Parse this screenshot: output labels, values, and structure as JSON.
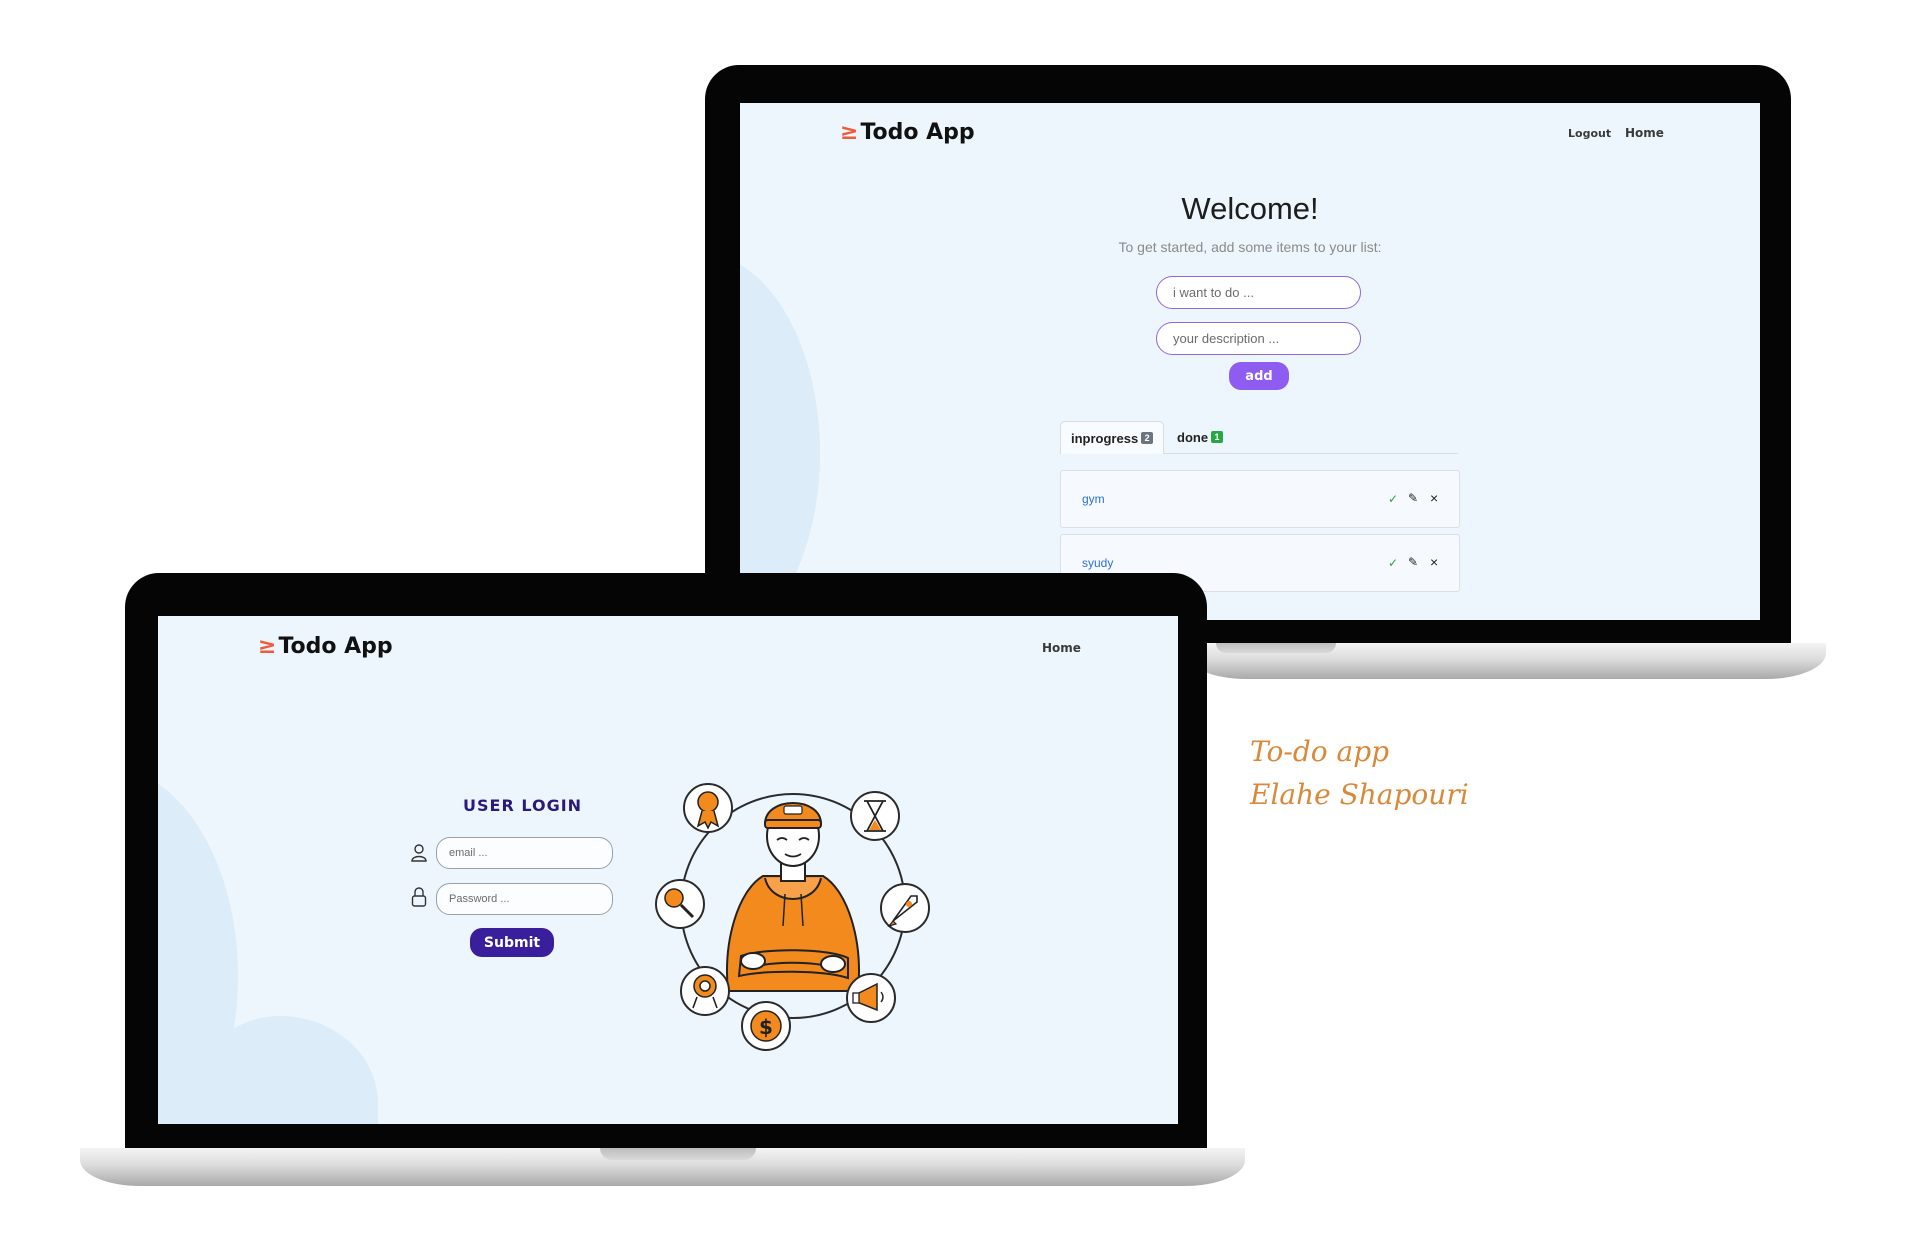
{
  "brand": {
    "bolt_glyph": "≥",
    "app_name": "Todo App",
    "accent_color": "#ee5c3b"
  },
  "todo_screen": {
    "nav": {
      "logout": "Logout",
      "home": "Home"
    },
    "welcome_title": "Welcome!",
    "subtitle": "To get started, add some items to your list:",
    "todo_input_placeholder": "i want to do ...",
    "description_input_placeholder": "your description ...",
    "add_label": "add",
    "tabs": [
      {
        "label": "inprogress",
        "count": "2",
        "badge_color": "#6c757d"
      },
      {
        "label": "done",
        "count": "1",
        "badge_color": "#28a745"
      }
    ],
    "items": [
      {
        "text": "gym"
      },
      {
        "text": "syudy"
      }
    ],
    "item_icons": {
      "complete": "✓",
      "edit": "✎",
      "delete": "×"
    }
  },
  "login_screen": {
    "nav": {
      "home": "Home"
    },
    "title": "USER LOGIN",
    "email_placeholder": "email ...",
    "password_placeholder": "Password ...",
    "submit_label": "Submit",
    "illustration_icons": [
      "award-icon",
      "hourglass-icon",
      "search-icon",
      "rocket-icon",
      "target-icon",
      "dollar-icon",
      "megaphone-icon"
    ]
  },
  "caption": {
    "line1": "To-do app",
    "line2": "Elahe Shapouri"
  },
  "colors": {
    "screen_bg": "#eef6fd",
    "purple_accent": "#8e5cf0",
    "login_button": "#3a1f9c",
    "illustration_orange": "#f28a1e",
    "caption_color": "#d9893a"
  }
}
